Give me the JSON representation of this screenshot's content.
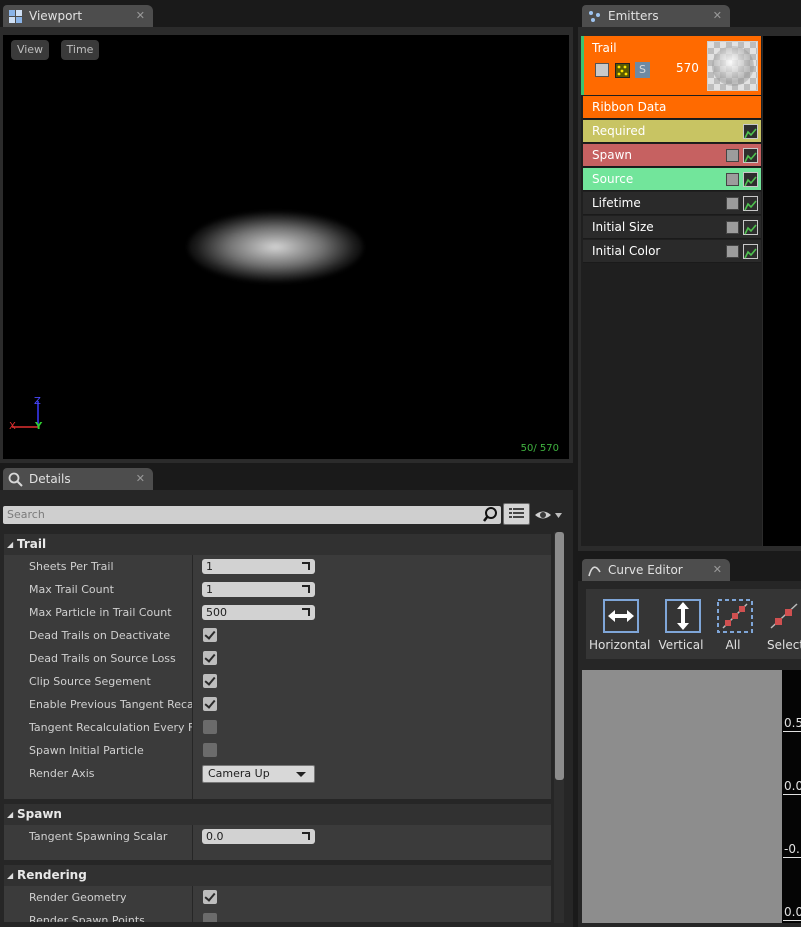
{
  "viewport": {
    "tab_title": "Viewport",
    "close_glyph": "✕",
    "view_btn": "View",
    "time_btn": "Time",
    "axis": {
      "z": "Z",
      "x": "X",
      "y": "Y"
    },
    "stat": "50/ 570"
  },
  "emitters": {
    "tab_title": "Emitters",
    "close_glyph": "✕",
    "emitter_name": "Trail",
    "particle_count": "570",
    "solo_label": "S",
    "modules": [
      {
        "label": "Ribbon Data",
        "color": "#ff6a00"
      },
      {
        "label": "Required",
        "color": "#c8c463"
      },
      {
        "label": "Spawn",
        "color": "#c66161"
      },
      {
        "label": "Source",
        "color": "#72e59b"
      },
      {
        "label": "Lifetime",
        "color": "#2a2a2a"
      },
      {
        "label": "Initial Size",
        "color": "#2a2a2a"
      },
      {
        "label": "Initial Color",
        "color": "#2a2a2a"
      }
    ]
  },
  "details": {
    "tab_title": "Details",
    "close_glyph": "✕",
    "search_placeholder": "Search",
    "categories": {
      "trail": "Trail",
      "spawn": "Spawn",
      "rendering": "Rendering"
    },
    "trail_props": [
      {
        "label": "Sheets Per Trail",
        "type": "number",
        "value": "1"
      },
      {
        "label": "Max Trail Count",
        "type": "number",
        "value": "1"
      },
      {
        "label": "Max Particle in Trail Count",
        "type": "number",
        "value": "500"
      },
      {
        "label": "Dead Trails on Deactivate",
        "type": "check",
        "value": true
      },
      {
        "label": "Dead Trails on Source Loss",
        "type": "check",
        "value": true
      },
      {
        "label": "Clip Source Segement",
        "type": "check",
        "value": true
      },
      {
        "label": "Enable Previous Tangent Recalculation",
        "type": "check",
        "value": true
      },
      {
        "label": "Tangent Recalculation Every Frame",
        "type": "check",
        "value": false
      },
      {
        "label": "Spawn Initial Particle",
        "type": "check",
        "value": false
      },
      {
        "label": "Render Axis",
        "type": "combo",
        "value": "Camera Up"
      }
    ],
    "spawn_props": [
      {
        "label": "Tangent Spawning Scalar",
        "type": "number",
        "value": "0.0"
      }
    ],
    "rendering_props": [
      {
        "label": "Render Geometry",
        "type": "check",
        "value": true
      },
      {
        "label": "Render Spawn Points",
        "type": "check",
        "value": false
      }
    ]
  },
  "curve_editor": {
    "tab_title": "Curve Editor",
    "close_glyph": "✕",
    "buttons": [
      "Horizontal",
      "Vertical",
      "All",
      "Selected"
    ],
    "y_ticks": [
      "0.5",
      "0.0",
      "-0.",
      "0.0"
    ]
  }
}
